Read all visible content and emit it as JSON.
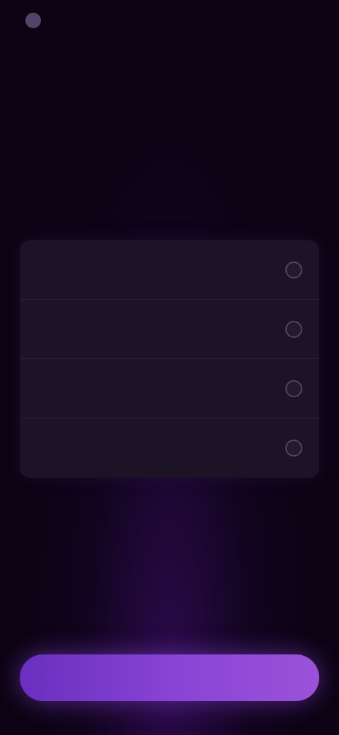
{
  "brand": {
    "name": ""
  },
  "nav": {
    "title": "",
    "action": ""
  },
  "headline": {
    "line1": "",
    "accent": ""
  },
  "subtext": "",
  "options": [
    {
      "label": ""
    },
    {
      "label": ""
    },
    {
      "label": ""
    },
    {
      "label": ""
    }
  ],
  "cta": {
    "label": ""
  },
  "colors": {
    "background": "#0c0314",
    "card": "#1c1326",
    "accent": "#7a5ab8",
    "cta_start": "#6a2fc0",
    "cta_end": "#9b52d8"
  }
}
